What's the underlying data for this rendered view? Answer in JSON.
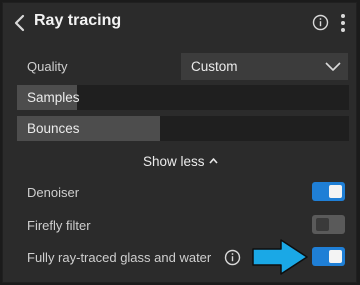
{
  "header": {
    "title": "Ray tracing",
    "back_icon": "chevron-left-icon",
    "info_icon": "info-icon",
    "more_icon": "more-vertical-icon"
  },
  "quality": {
    "label": "Quality",
    "value": "Custom"
  },
  "sliders": {
    "samples": {
      "label": "Samples",
      "fill_percent": 18
    },
    "bounces": {
      "label": "Bounces",
      "fill_percent": 43
    }
  },
  "show_less": {
    "label": "Show less"
  },
  "options": {
    "denoiser": {
      "label": "Denoiser",
      "enabled": true
    },
    "firefly_filter": {
      "label": "Firefly filter",
      "enabled": false
    },
    "glass_water": {
      "label": "Fully ray-traced glass and water",
      "enabled": true
    }
  },
  "colors": {
    "panel_bg": "#2b2b2b",
    "toggle_on": "#1f7fd6",
    "toggle_off": "#5a5a5a",
    "arrow": "#1aa8e6"
  }
}
